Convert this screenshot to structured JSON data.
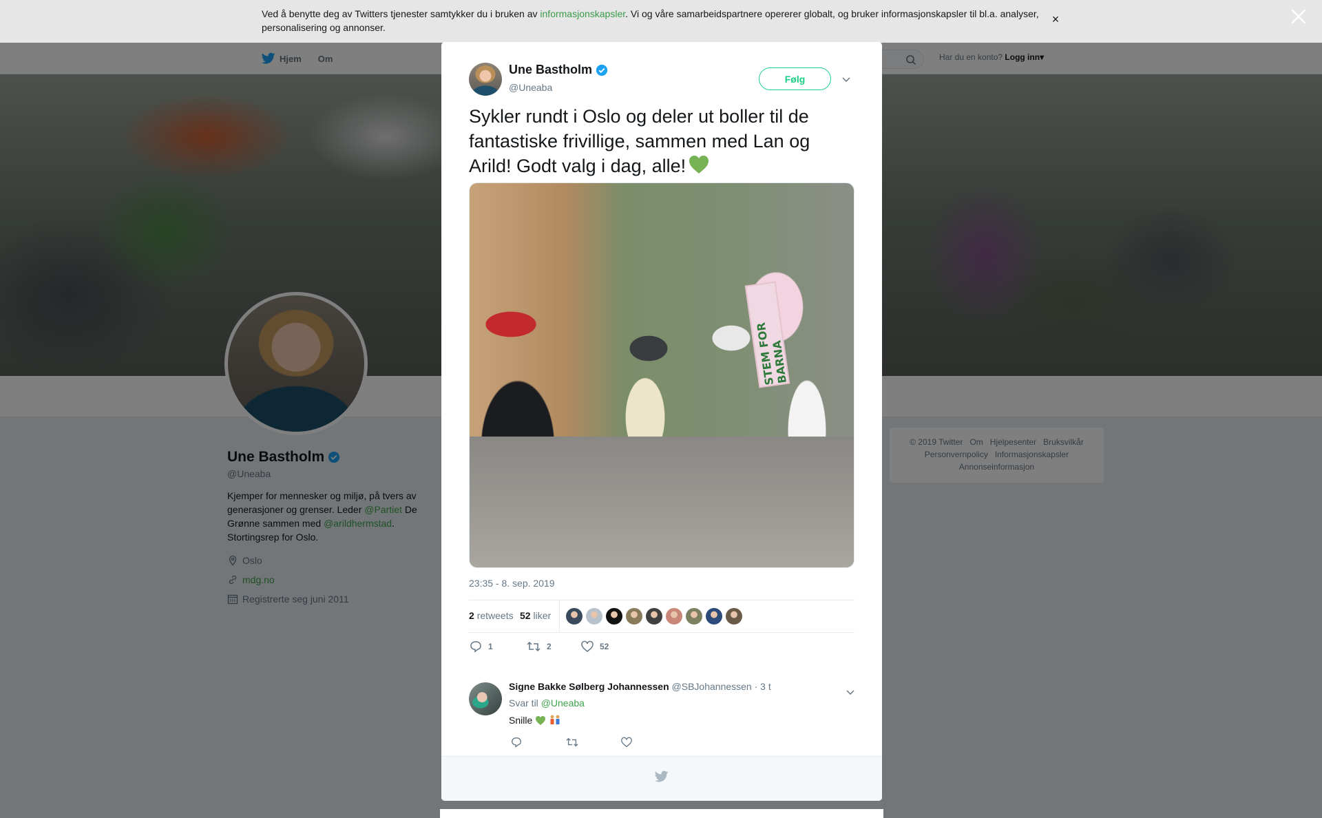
{
  "cookie": {
    "text_before": "Ved å benytte deg av Twitters tjenester samtykker du i bruken av ",
    "link": "informasjonskapsler",
    "text_after": ". Vi og våre samarbeidspartnere opererer globalt, og bruker informasjonskapsler til bl.a. analyser, personalisering og annonser.",
    "close": "×"
  },
  "nav": {
    "home": "Hjem",
    "about": "Om",
    "account_prompt": "Har du en konto?",
    "login": "Logg inn",
    "login_caret": "▾"
  },
  "profile": {
    "name": "Une Bastholm",
    "handle": "@Uneaba",
    "bio_1": "Kjemper for mennesker og miljø, på tvers av generasjoner og grenser. Leder ",
    "bio_link_1": "@Partiet",
    "bio_2": " De Grønne sammen med ",
    "bio_link_2": "@arildhermstad",
    "bio_3": ". Stortingsrep for Oslo.",
    "location": "Oslo",
    "website": "mdg.no",
    "joined": "Registrerte seg juni 2011"
  },
  "footer": {
    "links": [
      "© 2019 Twitter",
      "Om",
      "Hjelpesenter",
      "Bruksvilkår",
      "Personvernpolicy",
      "Informasjonskapsler",
      "Annonseinformasjon"
    ]
  },
  "tweet": {
    "author": "Une Bastholm",
    "handle": "@Uneaba",
    "follow": "Følg",
    "text": "Sykler rundt i Oslo og deler ut boller til de fantastiske frivillige, sammen med Lan og Arild! Godt valg i dag, alle!",
    "sign_text": "STEM FOR BARNA",
    "timestamp": "23:35 - 8. sep. 2019",
    "retweets_count": "2",
    "retweets_label": "retweets",
    "likes_count": "52",
    "likes_label": "liker",
    "reply_count": "1",
    "retweet_count": "2",
    "like_count": "52"
  },
  "liker_colors": [
    "#3a4a5c",
    "#b8c2cc",
    "#111111",
    "#8a7a5c",
    "#404040",
    "#c9877a",
    "#7a8060",
    "#2c4a7a",
    "#6a5a48"
  ],
  "reply": {
    "name": "Signe Bakke Sølberg Johannessen",
    "handle": "@SBJohannessen",
    "time": "· 3 t",
    "reply_to_label": "Svar til",
    "reply_to_handle": "@Uneaba",
    "text": "Snille"
  },
  "colors": {
    "accent_green": "#19cf86",
    "link_green": "#3fa34d",
    "verified_blue": "#1da1f2"
  }
}
